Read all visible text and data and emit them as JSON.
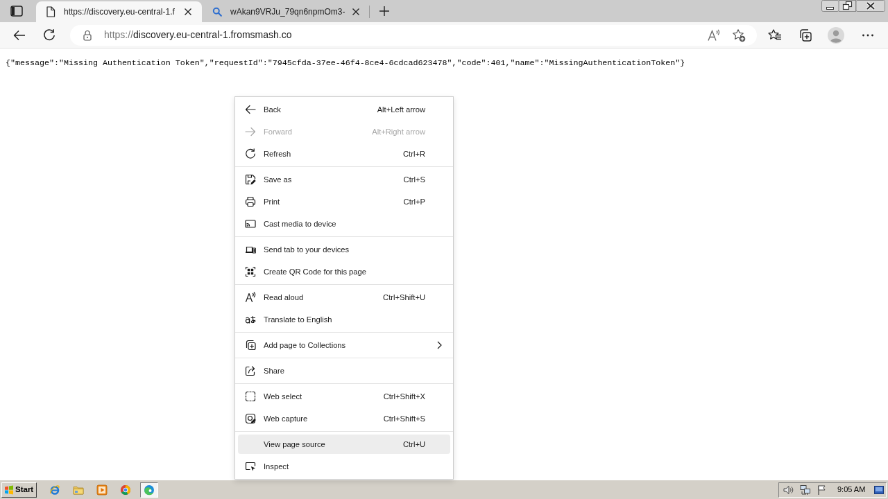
{
  "tabs": [
    {
      "label": "https://discovery.eu-central-1.f",
      "selected": true
    },
    {
      "label": "wAkan9VRJu_79qn6npmOm3-",
      "selected": false
    }
  ],
  "address_bar": {
    "scheme": "https://",
    "host": "discovery.eu-central-1.fromsmash.co"
  },
  "page": {
    "text": "{\"message\":\"Missing Authentication Token\",\"requestId\":\"7945cfda-37ee-46f4-8ce4-6cdcad623478\",\"code\":401,\"name\":\"MissingAuthenticationToken\"}"
  },
  "context_menu": {
    "groups": [
      {
        "items": [
          {
            "label": "Back",
            "shortcut": "Alt+Left arrow",
            "disabled": false,
            "selected": false,
            "submenu": false
          },
          {
            "label": "Forward",
            "shortcut": "Alt+Right arrow",
            "disabled": true,
            "selected": false,
            "submenu": false
          },
          {
            "label": "Refresh",
            "shortcut": "Ctrl+R",
            "disabled": false,
            "selected": false,
            "submenu": false
          }
        ]
      },
      {
        "items": [
          {
            "label": "Save as",
            "shortcut": "Ctrl+S",
            "disabled": false,
            "selected": false,
            "submenu": false
          },
          {
            "label": "Print",
            "shortcut": "Ctrl+P",
            "disabled": false,
            "selected": false,
            "submenu": false
          },
          {
            "label": "Cast media to device",
            "disabled": false,
            "selected": false,
            "submenu": false
          }
        ]
      },
      {
        "items": [
          {
            "label": "Send tab to your devices",
            "disabled": false,
            "selected": false,
            "submenu": false
          },
          {
            "label": "Create QR Code for this page",
            "disabled": false,
            "selected": false,
            "submenu": false
          }
        ]
      },
      {
        "items": [
          {
            "label": "Read aloud",
            "shortcut": "Ctrl+Shift+U",
            "disabled": false,
            "selected": false,
            "submenu": false
          },
          {
            "label": "Translate to English",
            "disabled": false,
            "selected": false,
            "submenu": false
          }
        ]
      },
      {
        "items": [
          {
            "label": "Add page to Collections",
            "disabled": false,
            "selected": false,
            "submenu": true
          }
        ]
      },
      {
        "items": [
          {
            "label": "Share",
            "disabled": false,
            "selected": false,
            "submenu": false
          }
        ]
      },
      {
        "items": [
          {
            "label": "Web select",
            "shortcut": "Ctrl+Shift+X",
            "disabled": false,
            "selected": false,
            "submenu": false
          },
          {
            "label": "Web capture",
            "shortcut": "Ctrl+Shift+S",
            "disabled": false,
            "selected": false,
            "submenu": false
          }
        ]
      },
      {
        "items": [
          {
            "label": "View page source",
            "shortcut": "Ctrl+U",
            "disabled": false,
            "selected": true,
            "submenu": false
          },
          {
            "label": "Inspect",
            "disabled": false,
            "selected": false,
            "submenu": false
          }
        ]
      }
    ]
  },
  "taskbar": {
    "start": "Start",
    "apps": [
      {
        "selected": false
      },
      {
        "selected": false
      },
      {
        "selected": false
      },
      {
        "selected": false
      },
      {
        "selected": true
      }
    ],
    "clock": "9:05 AM"
  }
}
